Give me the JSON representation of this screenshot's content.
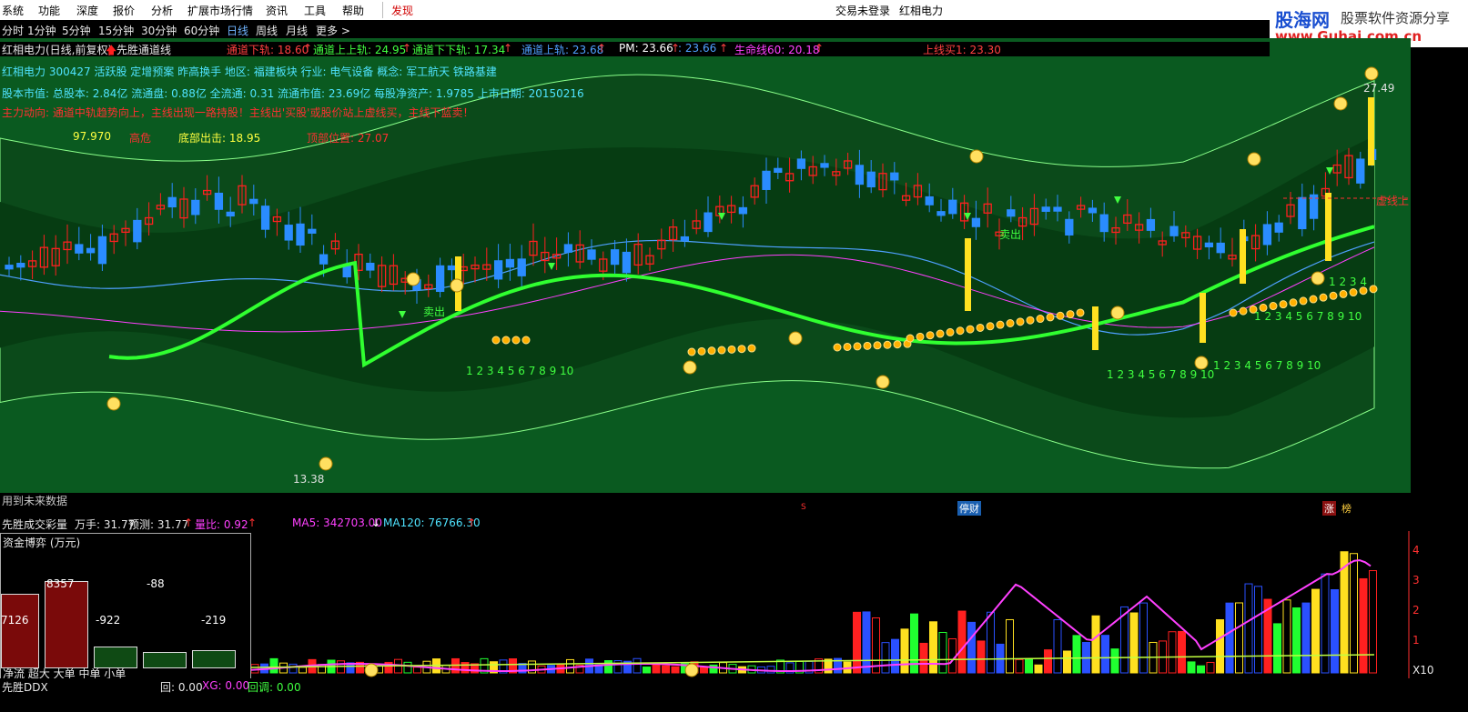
{
  "menubar": {
    "items": [
      "系统",
      "功能",
      "深度",
      "报价",
      "分析",
      "扩展市场行情",
      "资讯",
      "工具",
      "帮助",
      "发现"
    ],
    "status": "交易未登录",
    "stock": "红相电力"
  },
  "logo": {
    "brand": "股海网",
    "tagline": "股票软件资源分享",
    "url": "www.Guhai.com.cn"
  },
  "periods": [
    "分时",
    "1分钟",
    "5分钟",
    "15分钟",
    "30分钟",
    "60分钟",
    "日线",
    "周线",
    "月线",
    "更多 >"
  ],
  "active_period": "日线",
  "indicator_bar": {
    "title": "红相电力(日线,前复权)",
    "indicator": "先胜通道线",
    "items": [
      {
        "label": "通道下轨: 18.60",
        "arrow": "↑",
        "color": "#ff4040"
      },
      {
        "label": "通道上上轨: 24.95",
        "arrow": "↑",
        "color": "#40ff40"
      },
      {
        "label": "通道下下轨: 17.34",
        "arrow": "↑",
        "color": "#40ff40"
      },
      {
        "label": "通道上轨: 23.68",
        "arrow": "↑",
        "color": "#4fa0ff"
      },
      {
        "label": "PM: 23.66",
        "arrow": "↑",
        "color": "#ffffff"
      },
      {
        "label": ": 23.66",
        "arrow": "↑",
        "color": "#4fa0ff"
      },
      {
        "label": "生命线60: 20.18",
        "arrow": "↑",
        "color": "#ff40ff"
      },
      {
        "label": "上线买1: 23.30",
        "arrow": "",
        "color": "#ff4040"
      }
    ]
  },
  "info_lines": {
    "line1": "红相电力 300427 活跃股 定增预案 昨高换手  地区: 福建板块  行业: 电气设备  概念: 军工航天 铁路基建",
    "line2": "股本市值: 总股本: 2.84亿 流通盘: 0.88亿 全流通: 0.31 流通市值: 23.69亿 每股净资产: 1.9785 上市日期: 20150216",
    "line3": "主力动向: 通道中轨趋势向上，主线出现一路持股！主线出'买股'或股价站上虚线买，主线下蓝卖！",
    "line4_value": "97.970",
    "line4_risk": "高危",
    "line4_bottom": "底部出击: 18.95",
    "line4_top": "顶部位置: 27.07"
  },
  "chart_labels": {
    "high_price": "27.49",
    "low_price": "13.38",
    "sell1": "卖出",
    "sell2": "卖出",
    "dashed_buy": "虚线上",
    "count_seq": "1 2 3 4 5 6 7 8 9 10",
    "count_short": "1 2 3 4"
  },
  "subbar": {
    "future_note": "用到未来数据",
    "mark_s": "S",
    "mark_stop": "停财",
    "mark_zhang": "涨",
    "mark_bang": "榜"
  },
  "volume_info": {
    "title": "先胜成交彩量",
    "hand": "万手: 31.77",
    "predict": "预测: 31.77",
    "ratio": "量比: 0.92",
    "ma5": "MA5: 342703.00",
    "ma120": "MA120: 76766.30",
    "axis_ticks": [
      "4",
      "3",
      "2",
      "1"
    ],
    "axis_unit": "X10"
  },
  "capital_box": {
    "title": "资金博弈 (万元)",
    "bars": [
      {
        "label": "7126",
        "value": 7126,
        "color": "#7a0a0a"
      },
      {
        "label": "8357",
        "value": 8357,
        "color": "#7a0a0a"
      },
      {
        "label": "-922",
        "value": -922,
        "color": "#0f4a14"
      },
      {
        "label": "-88",
        "value": -88,
        "color": "#0f4a14"
      },
      {
        "label": "-219",
        "value": -219,
        "color": "#0f4a14"
      }
    ],
    "legend": "净流 超大 大单 中单 小单"
  },
  "ddx_bar": {
    "name": "先胜DDX",
    "hui": "回: 0.00",
    "xg": "XG: 0.00",
    "huidiao": "回调: 0.00"
  },
  "colors": {
    "channel_fill": "#0b4a1a",
    "channel_inner": "#063c12",
    "bull_candle": "#ff2020",
    "bear_candle": "#2a8cff",
    "lifeline": "#30ff30",
    "midline": "#4fa0ff",
    "ma60": "#ff40ff"
  }
}
